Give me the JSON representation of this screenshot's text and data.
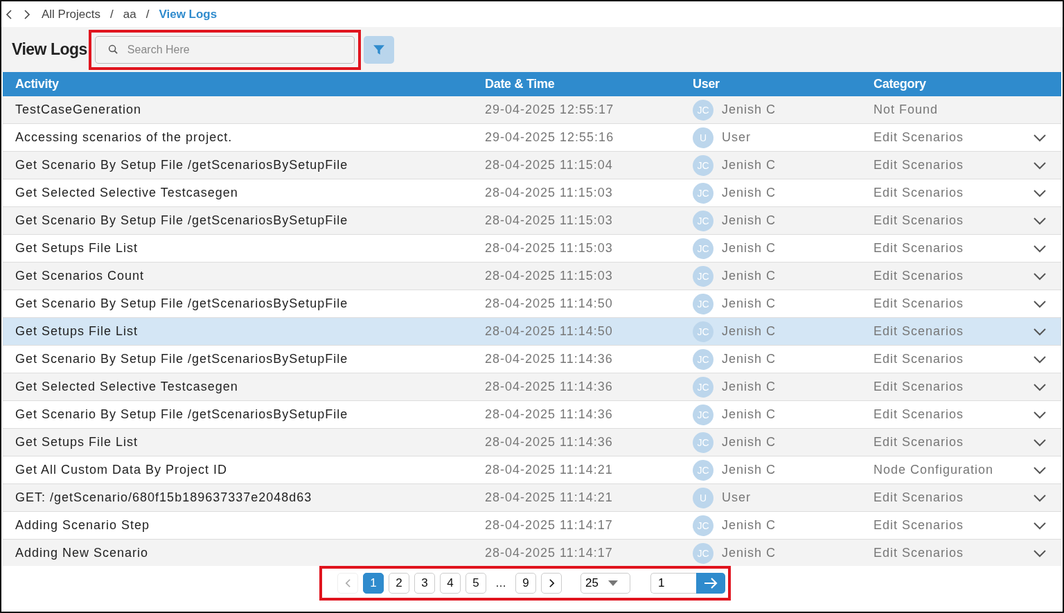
{
  "breadcrumb": [
    "All Projects",
    "aa",
    "View Logs"
  ],
  "breadcrumb_separator": "/",
  "page_title": "View Logs",
  "search": {
    "placeholder": "Search Here",
    "highlighted": true
  },
  "table": {
    "columns": [
      "Activity",
      "Date & Time",
      "User",
      "Category"
    ],
    "rows": [
      {
        "activity": "TestCaseGeneration",
        "datetime": "29-04-2025 12:55:17",
        "initials": "JC",
        "user": "Jenish C",
        "category": "Not Found",
        "expandable": false,
        "selected": false
      },
      {
        "activity": "Accessing scenarios of the project.",
        "datetime": "29-04-2025 12:55:16",
        "initials": "U",
        "user": "User",
        "category": "Edit Scenarios",
        "expandable": true,
        "selected": false
      },
      {
        "activity": "Get Scenario By Setup File /getScenariosBySetupFile",
        "datetime": "28-04-2025 11:15:04",
        "initials": "JC",
        "user": "Jenish C",
        "category": "Edit Scenarios",
        "expandable": true,
        "selected": false
      },
      {
        "activity": "Get Selected Selective Testcasegen",
        "datetime": "28-04-2025 11:15:03",
        "initials": "JC",
        "user": "Jenish C",
        "category": "Edit Scenarios",
        "expandable": true,
        "selected": false
      },
      {
        "activity": "Get Scenario By Setup File /getScenariosBySetupFile",
        "datetime": "28-04-2025 11:15:03",
        "initials": "JC",
        "user": "Jenish C",
        "category": "Edit Scenarios",
        "expandable": true,
        "selected": false
      },
      {
        "activity": "Get Setups File List",
        "datetime": "28-04-2025 11:15:03",
        "initials": "JC",
        "user": "Jenish C",
        "category": "Edit Scenarios",
        "expandable": true,
        "selected": false
      },
      {
        "activity": "Get Scenarios Count",
        "datetime": "28-04-2025 11:15:03",
        "initials": "JC",
        "user": "Jenish C",
        "category": "Edit Scenarios",
        "expandable": true,
        "selected": false
      },
      {
        "activity": "Get Scenario By Setup File /getScenariosBySetupFile",
        "datetime": "28-04-2025 11:14:50",
        "initials": "JC",
        "user": "Jenish C",
        "category": "Edit Scenarios",
        "expandable": true,
        "selected": false
      },
      {
        "activity": "Get Setups File List",
        "datetime": "28-04-2025 11:14:50",
        "initials": "JC",
        "user": "Jenish C",
        "category": "Edit Scenarios",
        "expandable": true,
        "selected": true
      },
      {
        "activity": "Get Scenario By Setup File /getScenariosBySetupFile",
        "datetime": "28-04-2025 11:14:36",
        "initials": "JC",
        "user": "Jenish C",
        "category": "Edit Scenarios",
        "expandable": true,
        "selected": false
      },
      {
        "activity": "Get Selected Selective Testcasegen",
        "datetime": "28-04-2025 11:14:36",
        "initials": "JC",
        "user": "Jenish C",
        "category": "Edit Scenarios",
        "expandable": true,
        "selected": false
      },
      {
        "activity": "Get Scenario By Setup File /getScenariosBySetupFile",
        "datetime": "28-04-2025 11:14:36",
        "initials": "JC",
        "user": "Jenish C",
        "category": "Edit Scenarios",
        "expandable": true,
        "selected": false
      },
      {
        "activity": "Get Setups File List",
        "datetime": "28-04-2025 11:14:36",
        "initials": "JC",
        "user": "Jenish C",
        "category": "Edit Scenarios",
        "expandable": true,
        "selected": false
      },
      {
        "activity": "Get All Custom Data By Project ID",
        "datetime": "28-04-2025 11:14:21",
        "initials": "JC",
        "user": "Jenish C",
        "category": "Node Configuration",
        "expandable": true,
        "selected": false
      },
      {
        "activity": "GET: /getScenario/680f15b189637337e2048d63",
        "datetime": "28-04-2025 11:14:21",
        "initials": "U",
        "user": "User",
        "category": "Edit Scenarios",
        "expandable": true,
        "selected": false
      },
      {
        "activity": "Adding Scenario Step",
        "datetime": "28-04-2025 11:14:17",
        "initials": "JC",
        "user": "Jenish C",
        "category": "Edit Scenarios",
        "expandable": true,
        "selected": false
      },
      {
        "activity": "Adding New Scenario",
        "datetime": "28-04-2025 11:14:17",
        "initials": "JC",
        "user": "Jenish C",
        "category": "Edit Scenarios",
        "expandable": true,
        "selected": false
      }
    ]
  },
  "pagination": {
    "highlighted": true,
    "pages": [
      {
        "label": "1",
        "selected": true
      },
      {
        "label": "2",
        "selected": false
      },
      {
        "label": "3",
        "selected": false
      },
      {
        "label": "4",
        "selected": false
      },
      {
        "label": "5",
        "selected": false
      },
      {
        "label": "…",
        "kind": "ellipsis"
      },
      {
        "label": "9",
        "selected": false
      }
    ],
    "prev_disabled": true,
    "next_disabled": false,
    "page_size": "25",
    "goto_value": "1"
  }
}
